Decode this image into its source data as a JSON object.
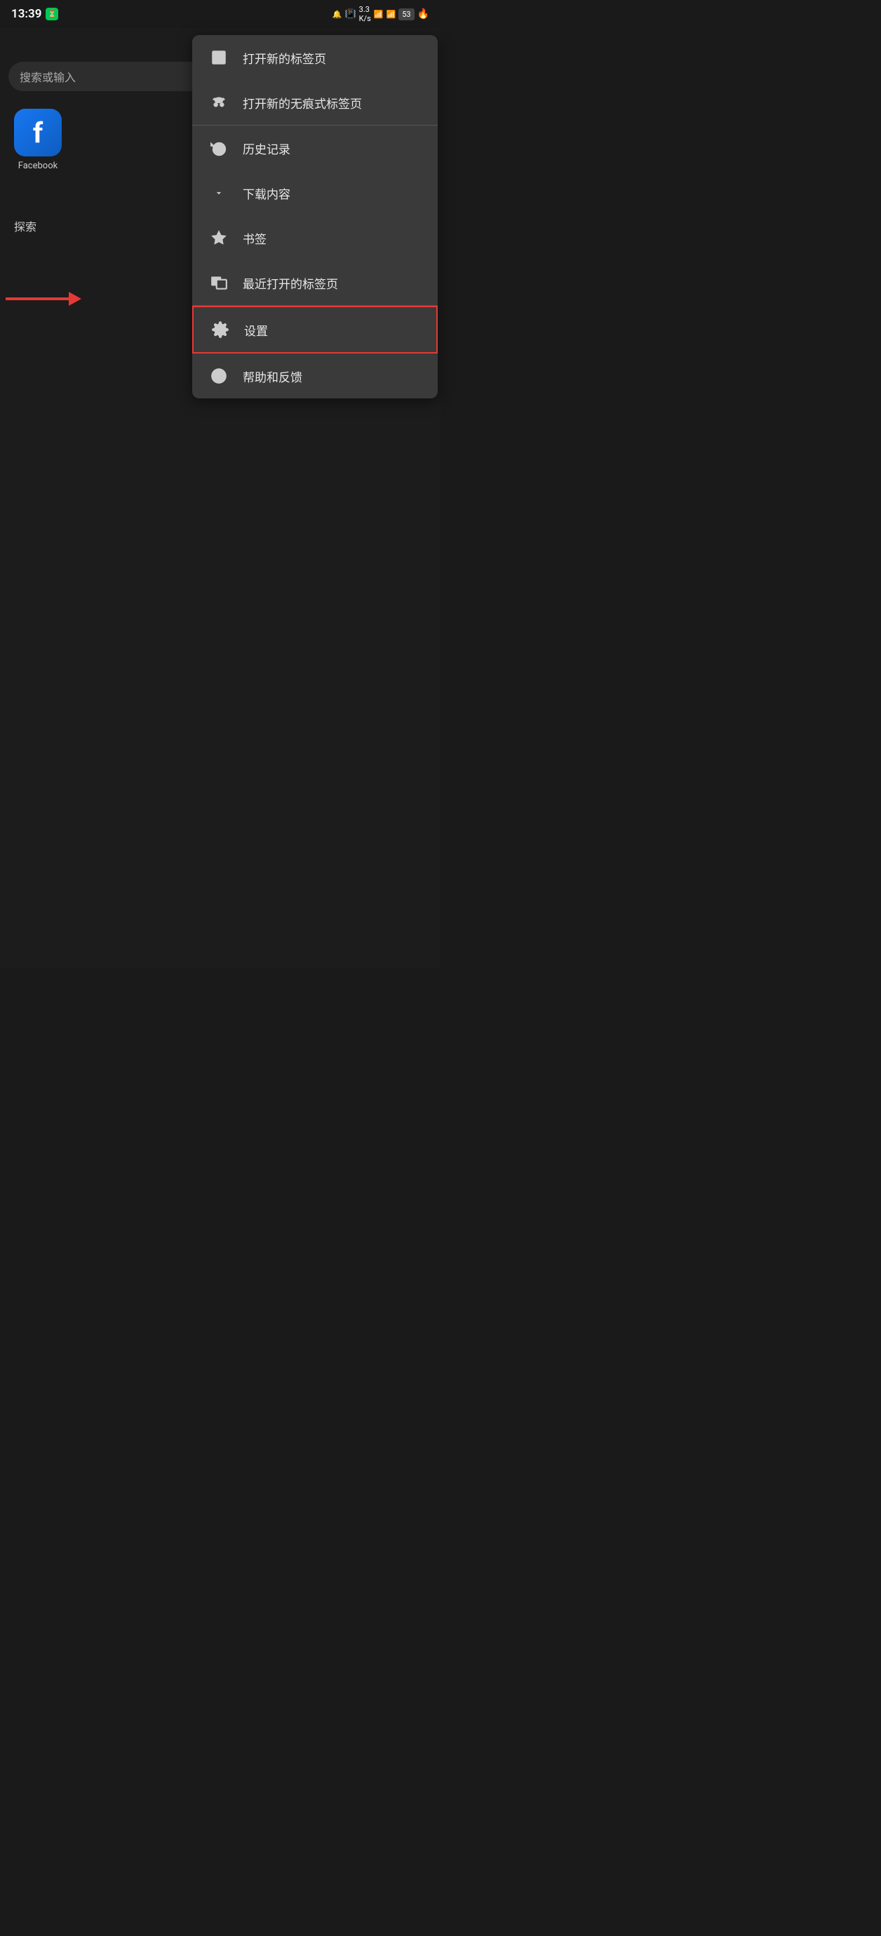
{
  "statusBar": {
    "time": "13:39",
    "battery": "53"
  },
  "browser": {
    "searchPlaceholder": "搜索或输入",
    "exploreLabel": "探索",
    "facebook": {
      "label": "Facebook"
    }
  },
  "menu": {
    "items": [
      {
        "id": "new-tab",
        "label": "打开新的标签页",
        "icon": "plus-square"
      },
      {
        "id": "incognito",
        "label": "打开新的无痕式标签页",
        "icon": "incognito"
      },
      {
        "id": "history",
        "label": "历史记录",
        "icon": "history"
      },
      {
        "id": "downloads",
        "label": "下载内容",
        "icon": "download"
      },
      {
        "id": "bookmarks",
        "label": "书签",
        "icon": "star"
      },
      {
        "id": "recent-tabs",
        "label": "最近打开的标签页",
        "icon": "recent-tabs"
      },
      {
        "id": "settings",
        "label": "设置",
        "icon": "gear",
        "highlighted": true
      },
      {
        "id": "help",
        "label": "帮助和反馈",
        "icon": "help"
      }
    ]
  }
}
